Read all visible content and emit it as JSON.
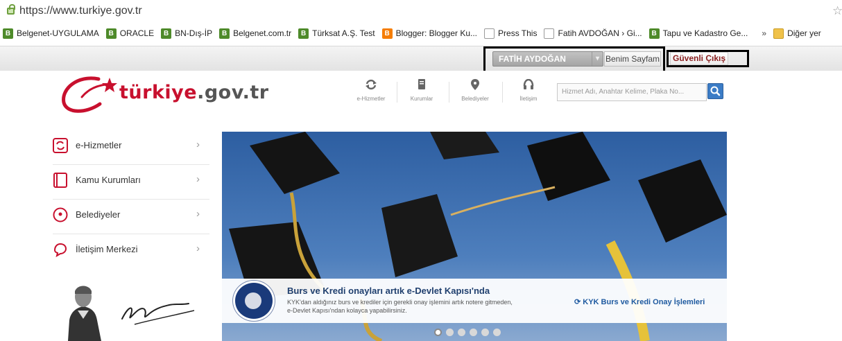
{
  "browser": {
    "url": "https://www.turkiye.gov.tr",
    "bookmarks": [
      {
        "label": "Belgenet-UYGULAMA",
        "icon": "b-icon"
      },
      {
        "label": "ORACLE",
        "icon": "b-icon"
      },
      {
        "label": "BN-Dış-İP",
        "icon": "b-icon"
      },
      {
        "label": "Belgenet.com.tr",
        "icon": "b-icon"
      },
      {
        "label": "Türksat A.Ş. Test",
        "icon": "b-icon"
      },
      {
        "label": "Blogger: Blogger Ku...",
        "icon": "blogger-icon"
      },
      {
        "label": "Press This",
        "icon": "page-icon"
      },
      {
        "label": "Fatih AVDOĞAN › Gi...",
        "icon": "page-icon"
      },
      {
        "label": "Tapu ve Kadastro Ge...",
        "icon": "b-icon"
      }
    ],
    "more_label": "»",
    "other_bookmarks": "Diğer yer"
  },
  "topbar": {
    "user_name": "FATİH AYDOĞAN",
    "my_page": "Benim Sayfam",
    "logout": "Güvenli Çıkış"
  },
  "header": {
    "logo_main": "türkiye",
    "logo_suffix": ".gov.tr",
    "nav": [
      {
        "label": "e-Hizmetler"
      },
      {
        "label": "Kurumlar"
      },
      {
        "label": "Belediyeler"
      },
      {
        "label": "İletişim"
      }
    ],
    "search_placeholder": "Hizmet Adı, Anahtar Kelime, Plaka No..."
  },
  "sidebar": {
    "items": [
      {
        "label": "e-Hizmetler"
      },
      {
        "label": "Kamu Kurumları"
      },
      {
        "label": "Belediyeler"
      },
      {
        "label": "İletişim Merkezi"
      }
    ]
  },
  "banner": {
    "title": "Burs ve Kredi onayları artık e-Devlet Kapısı'nda",
    "description": "KYK'dan aldığınız burs ve krediler için gerekli onay işlemini artık notere gitmeden, e-Devlet Kapısı'ndan kolayca yapabilirsiniz.",
    "link": "KYK Burs ve Kredi Onay İşlemleri",
    "slide_count": 6,
    "active_slide": 1
  },
  "colors": {
    "brand_red": "#c8102e",
    "link_blue": "#1f5aa0",
    "highlight_frame": "#000000"
  }
}
